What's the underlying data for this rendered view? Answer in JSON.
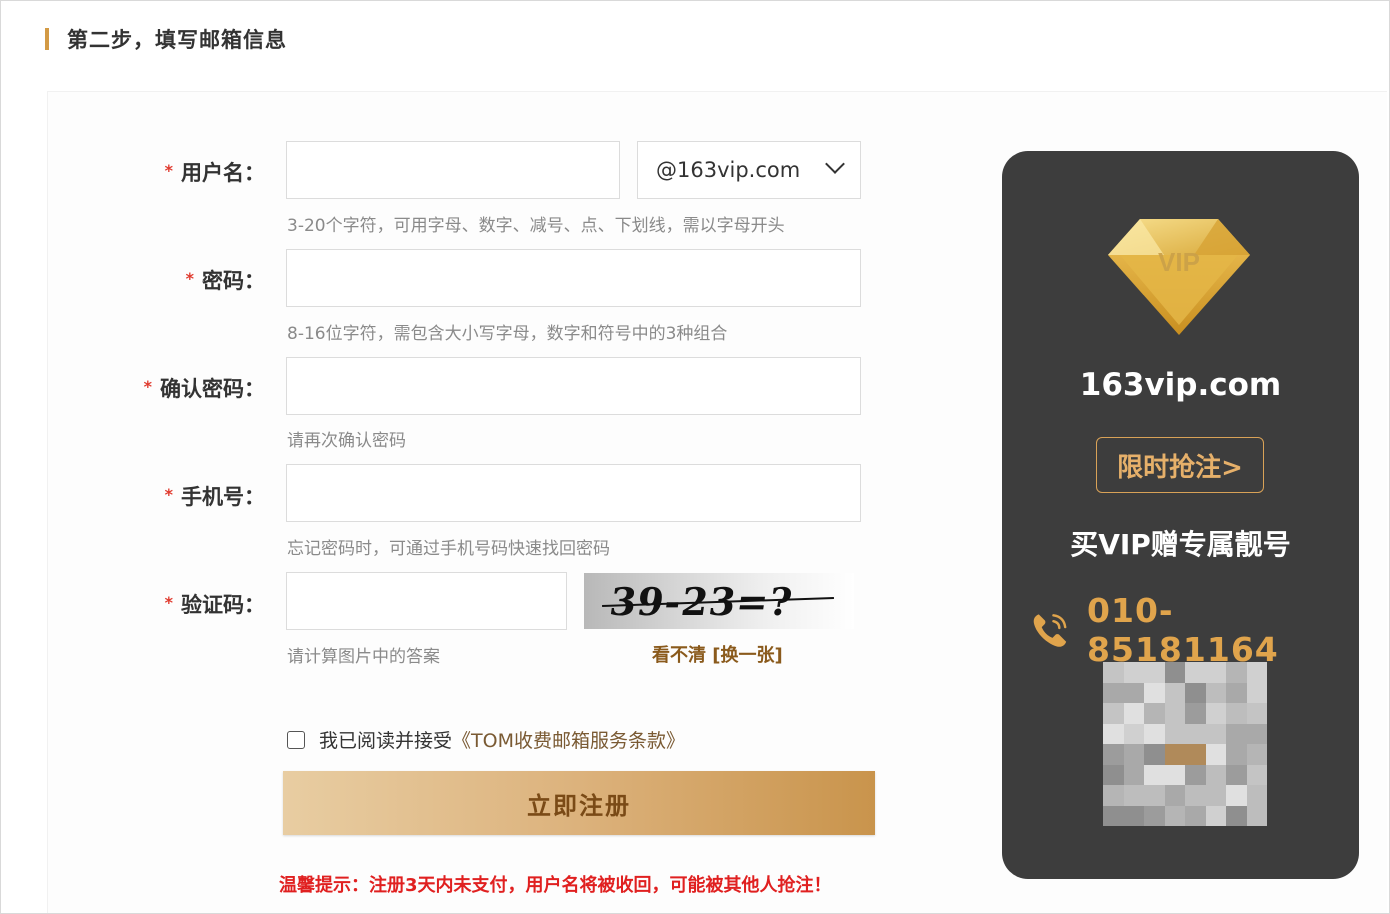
{
  "step": {
    "title": "第二步，填写邮箱信息"
  },
  "form": {
    "username": {
      "label": "用户名：",
      "value": "",
      "domain": "@163vip.com",
      "hint": "3-20个字符，可用字母、数字、减号、点、下划线，需以字母开头"
    },
    "password": {
      "label": "密码：",
      "value": "",
      "hint": "8-16位字符，需包含大小写字母，数字和符号中的3种组合"
    },
    "confirm_password": {
      "label": "确认密码：",
      "value": "",
      "hint": "请再次确认密码"
    },
    "phone": {
      "label": "手机号：",
      "value": "",
      "hint": "忘记密码时，可通过手机号码快速找回密码"
    },
    "captcha": {
      "label": "验证码：",
      "value": "",
      "hint": "请计算图片中的答案",
      "image_text": "39-23=?",
      "refresh": "看不清 [换一张]"
    },
    "required_marker": "*",
    "agree": {
      "checked": false,
      "text": "我已阅读并接受",
      "link": "《TOM收费邮箱服务条款》"
    },
    "submit_label": "立即注册",
    "warning": "温馨提示：注册3天内未支付，用户名将被收回，可能被其他人抢注！"
  },
  "vip_card": {
    "badge_text": "VIP",
    "domain": "163vip.com",
    "promo_button": "限时抢注>",
    "slogan": "买VIP赠专属靓号",
    "phone": "010-85181164",
    "icons": [
      "diamond-icon",
      "phone-icon",
      "qr-code"
    ],
    "colors": {
      "card_bg": "#3d3d3d",
      "accent": "#e0a44c",
      "required": "#e03a2e",
      "warning": "#e02020"
    }
  }
}
